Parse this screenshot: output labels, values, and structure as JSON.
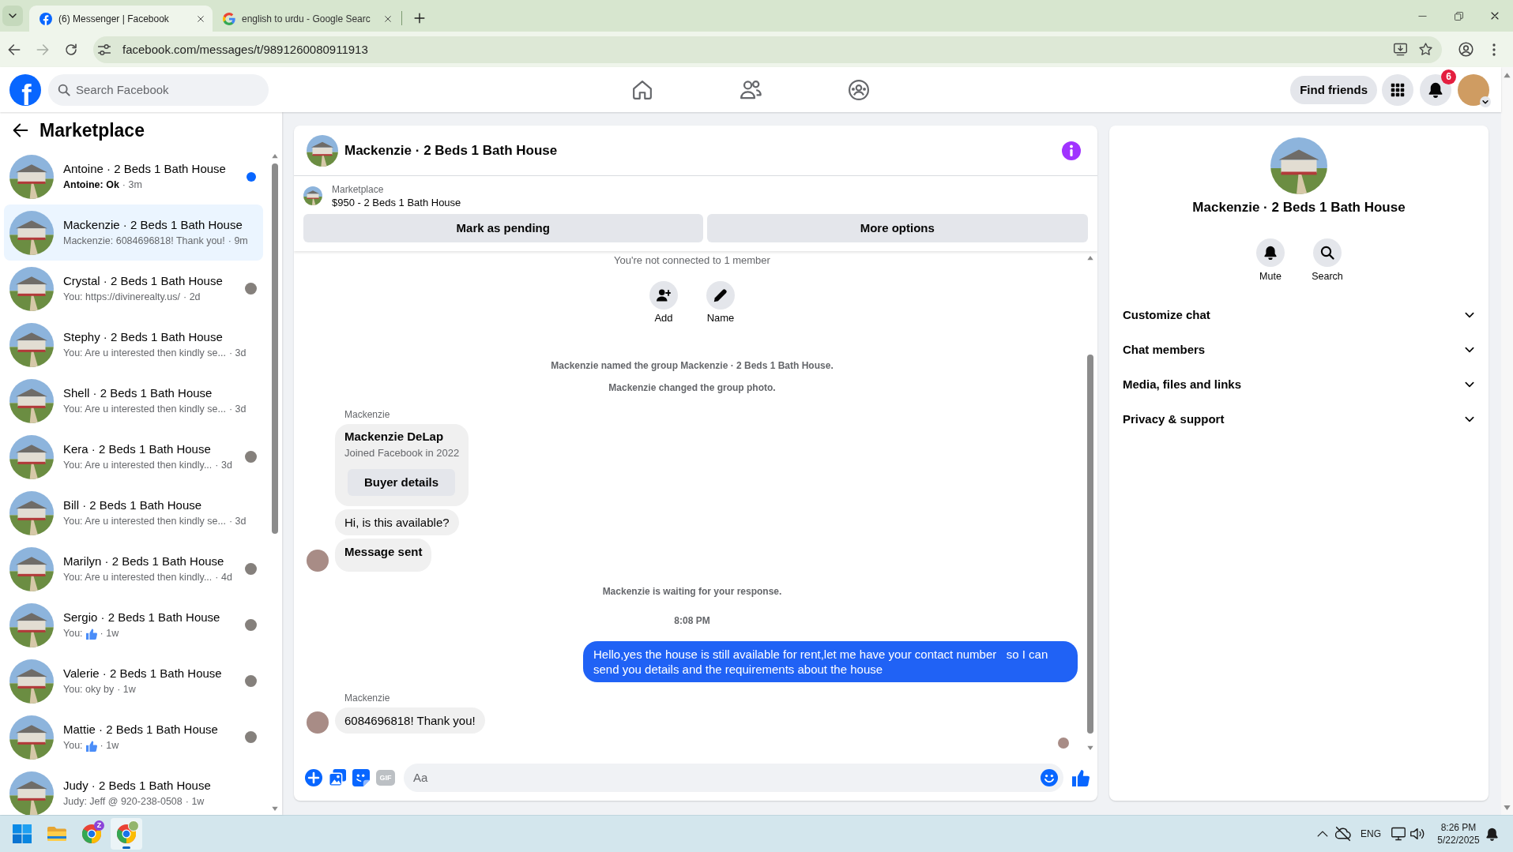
{
  "browser": {
    "tabs": [
      {
        "title": "(6) Messenger | Facebook",
        "selected": true
      },
      {
        "title": "english to urdu - Google Searc",
        "selected": false
      }
    ],
    "url": "facebook.com/messages/t/9891260080911913"
  },
  "header": {
    "logo": "f",
    "search": {
      "placeholder": "Search Facebook"
    },
    "find_friends": "Find friends",
    "notification_count": "6"
  },
  "sidebar": {
    "title": "Marketplace",
    "conversations": [
      {
        "title": "Antoine · 2 Beds 1 Bath House",
        "kind": "text",
        "preview": "Antoine: Ok",
        "time": "· 3m",
        "unread": true,
        "seen": false,
        "selected": false
      },
      {
        "title": "Mackenzie · 2 Beds 1 Bath House",
        "kind": "text",
        "preview": "Mackenzie: 6084696818! Thank you!",
        "time": "· 9m",
        "unread": false,
        "seen": false,
        "selected": true
      },
      {
        "title": "Crystal · 2 Beds 1 Bath House",
        "kind": "text",
        "preview": "You: https://divinerealty.us/",
        "time": "· 2d",
        "unread": false,
        "seen": true,
        "selected": false
      },
      {
        "title": "Stephy · 2 Beds 1 Bath House",
        "kind": "text",
        "preview": "You: Are u interested then kindly se...",
        "time": "· 3d",
        "unread": false,
        "seen": false,
        "selected": false
      },
      {
        "title": "Shell · 2 Beds 1 Bath House",
        "kind": "text",
        "preview": "You: Are u interested then kindly se...",
        "time": "· 3d",
        "unread": false,
        "seen": false,
        "selected": false
      },
      {
        "title": "Kera · 2 Beds 1 Bath House",
        "kind": "text",
        "preview": "You: Are u interested then kindly...",
        "time": "· 3d",
        "unread": false,
        "seen": true,
        "selected": false
      },
      {
        "title": "Bill · 2 Beds 1 Bath House",
        "kind": "text",
        "preview": "You: Are u interested then kindly se...",
        "time": "· 3d",
        "unread": false,
        "seen": false,
        "selected": false
      },
      {
        "title": "Marilyn · 2 Beds 1 Bath House",
        "kind": "text",
        "preview": "You: Are u interested then kindly...",
        "time": "· 4d",
        "unread": false,
        "seen": true,
        "selected": false
      },
      {
        "title": "Sergio · 2 Beds 1 Bath House",
        "kind": "like",
        "preview": "You:",
        "time": "· 1w",
        "unread": false,
        "seen": true,
        "selected": false
      },
      {
        "title": "Valerie · 2 Beds 1 Bath House",
        "kind": "text",
        "preview": "You: oky by",
        "time": "· 1w",
        "unread": false,
        "seen": true,
        "selected": false
      },
      {
        "title": "Mattie · 2 Beds 1 Bath House",
        "kind": "like",
        "preview": "You:",
        "time": "· 1w",
        "unread": false,
        "seen": true,
        "selected": false
      },
      {
        "title": "Judy · 2 Beds 1 Bath House",
        "kind": "text",
        "preview": "Judy: Jeff @ 920-238-0508",
        "time": "· 1w",
        "unread": false,
        "seen": false,
        "selected": false
      }
    ]
  },
  "chat": {
    "title": "Mackenzie · 2 Beds 1 Bath House",
    "listing": {
      "label": "Marketplace",
      "text": "$950 - 2 Beds 1 Bath House"
    },
    "actions": [
      "Mark as pending",
      "More options"
    ],
    "notice": "You're not connected to 1 member",
    "quick_actions": [
      {
        "kind": "add",
        "label": "Add"
      },
      {
        "kind": "name",
        "label": "Name"
      }
    ],
    "messages": [
      {
        "kind": "system",
        "text": "Mackenzie named the group Mackenzie · 2 Beds 1 Bath House."
      },
      {
        "kind": "system",
        "text": "Mackenzie changed the group photo."
      },
      {
        "kind": "profile",
        "sender": "Mackenzie",
        "name": "Mackenzie DeLap",
        "detail": "Joined Facebook in 2022",
        "button": "Buyer details",
        "avatar": false
      },
      {
        "kind": "incoming",
        "text": "Hi, is this available?",
        "avatar": false
      },
      {
        "kind": "status",
        "text": "Message sent",
        "avatar": true
      },
      {
        "kind": "system",
        "text": "Mackenzie is waiting for your response."
      },
      {
        "kind": "time",
        "text": "8:08 PM"
      },
      {
        "kind": "outgoing",
        "text": "Hello,yes the house is still available for rent,let me have your contact number   so I can send you details and the requirements about the house"
      },
      {
        "kind": "incoming",
        "sender": "Mackenzie",
        "text": "6084696818! Thank you!",
        "avatar": true
      }
    ],
    "seen": true,
    "composer": {
      "gif": "GIF",
      "placeholder": "Aa"
    }
  },
  "details": {
    "title": "Mackenzie · 2 Beds 1 Bath House",
    "actions": [
      {
        "kind": "mute",
        "label": "Mute"
      },
      {
        "kind": "search",
        "label": "Search"
      }
    ],
    "sections": [
      {
        "label": "Customize chat",
        "expanded": false
      },
      {
        "label": "Chat members",
        "expanded": false
      },
      {
        "label": "Media, files and links",
        "expanded": false
      },
      {
        "label": "Privacy & support",
        "expanded": false
      }
    ]
  },
  "taskbar": {
    "apps": [
      {
        "kind": "start",
        "selected": false,
        "photo_badge": false
      },
      {
        "kind": "files",
        "selected": false,
        "photo_badge": false
      },
      {
        "kind": "browser",
        "badge": "Z",
        "selected": false,
        "photo_badge": false
      },
      {
        "kind": "browser",
        "selected": true,
        "photo_badge": true
      }
    ],
    "language": "ENG",
    "time": "8:26 PM",
    "date": "5/22/2025"
  }
}
